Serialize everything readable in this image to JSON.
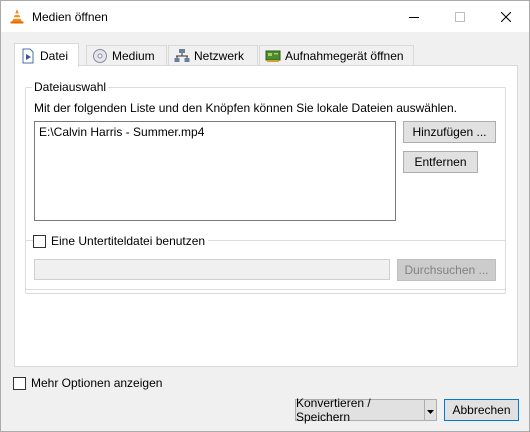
{
  "window": {
    "title": "Medien öffnen",
    "controls": {
      "minimize": "minimize-icon",
      "maximize": "maximize-icon",
      "close": "close-icon"
    }
  },
  "tabs": [
    {
      "label": "Datei",
      "icon": "file-icon",
      "active": true
    },
    {
      "label": "Medium",
      "icon": "disc-icon",
      "active": false
    },
    {
      "label": "Netzwerk",
      "icon": "network-icon",
      "active": false
    },
    {
      "label": "Aufnahmegerät öffnen",
      "icon": "capture-card-icon",
      "active": false
    }
  ],
  "file_section": {
    "legend": "Dateiauswahl",
    "description": "Mit der folgenden Liste und den Knöpfen können Sie lokale Dateien auswählen.",
    "files": [
      "E:\\Calvin Harris - Summer.mp4"
    ],
    "add_label": "Hinzufügen ...",
    "remove_label": "Entfernen"
  },
  "subtitle_section": {
    "checkbox_label": "Eine Untertiteldatei benutzen",
    "checked": false,
    "path_value": "",
    "browse_label": "Durchsuchen ..."
  },
  "footer": {
    "more_options_label": "Mehr Optionen anzeigen",
    "more_options_checked": false,
    "convert_label": "Konvertieren / Speichern",
    "cancel_label": "Abbrechen"
  },
  "colors": {
    "vlc_orange": "#f28c1a",
    "focus_blue": "#0078d7",
    "button_face": "#e1e1e1",
    "dialog_bg": "#f0f0f0"
  }
}
